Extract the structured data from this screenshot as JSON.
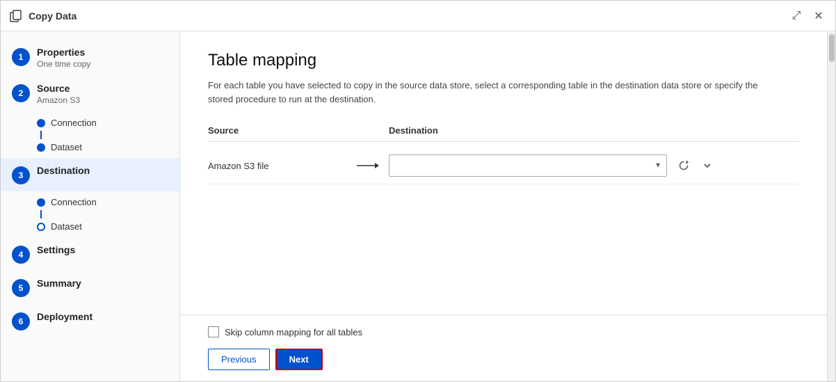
{
  "titleBar": {
    "title": "Copy Data",
    "expandIcon": "⤢",
    "closeIcon": "✕"
  },
  "sidebar": {
    "steps": [
      {
        "number": "1",
        "label": "Properties",
        "sublabel": "One time copy",
        "active": false,
        "subItems": []
      },
      {
        "number": "2",
        "label": "Source",
        "sublabel": "Amazon S3",
        "active": false,
        "subItems": [
          {
            "label": "Connection",
            "filled": true
          },
          {
            "label": "Dataset",
            "filled": true
          }
        ]
      },
      {
        "number": "3",
        "label": "Destination",
        "sublabel": "",
        "active": true,
        "subItems": [
          {
            "label": "Connection",
            "filled": true
          },
          {
            "label": "Dataset",
            "filled": false
          }
        ]
      },
      {
        "number": "4",
        "label": "Settings",
        "sublabel": "",
        "active": false,
        "subItems": []
      },
      {
        "number": "5",
        "label": "Summary",
        "sublabel": "",
        "active": false,
        "subItems": []
      },
      {
        "number": "6",
        "label": "Deployment",
        "sublabel": "",
        "active": false,
        "subItems": []
      }
    ]
  },
  "mainPanel": {
    "title": "Table mapping",
    "description": "For each table you have selected to copy in the source data store, select a corresponding table in the destination data store or specify the stored procedure to run at the destination.",
    "tableHeader": {
      "source": "Source",
      "destination": "Destination"
    },
    "mappingRows": [
      {
        "source": "Amazon S3 file",
        "destination": "",
        "destinationPlaceholder": ""
      }
    ],
    "skipCheckbox": {
      "label": "Skip column mapping for all tables",
      "checked": false
    },
    "buttons": {
      "previous": "Previous",
      "next": "Next"
    }
  }
}
